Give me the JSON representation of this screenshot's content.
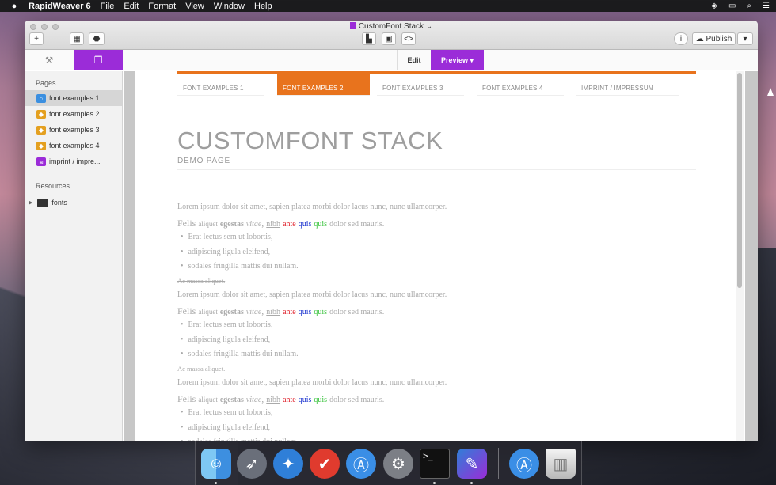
{
  "menubar": {
    "apple": "",
    "items": [
      "RapidWeaver 6",
      "File",
      "Edit",
      "Format",
      "View",
      "Window",
      "Help"
    ]
  },
  "window": {
    "title": "CustomFont Stack",
    "title_chevron": "⌄",
    "toolbar": {
      "add": "+",
      "archive": "▦",
      "plugin": "⬣",
      "view1": "▙",
      "view2": "▣",
      "code": "<>",
      "info": "i",
      "publish": "Publish",
      "publish_menu": "▾"
    },
    "tabs": {
      "edit": "Edit",
      "preview": "Preview ▾"
    }
  },
  "sidebar": {
    "pages_header": "Pages",
    "pages": [
      {
        "label": "font examples 1",
        "icon": "home-page-icon",
        "color": "#3b8fe0",
        "selected": true
      },
      {
        "label": "font examples 2",
        "icon": "stacks-page-icon",
        "color": "#e4a020",
        "selected": false
      },
      {
        "label": "font examples 3",
        "icon": "stacks-page-icon",
        "color": "#e4a020",
        "selected": false
      },
      {
        "label": "font examples 4",
        "icon": "stacks-page-icon",
        "color": "#e4a020",
        "selected": false
      },
      {
        "label": "imprint / impre...",
        "icon": "html-page-icon",
        "color": "#9b2cd8",
        "selected": false
      }
    ],
    "resources_header": "Resources",
    "resources": [
      {
        "label": "fonts",
        "icon": "folder-icon"
      }
    ]
  },
  "site": {
    "nav": [
      "FONT EXAMPLES 1",
      "FONT EXAMPLES 2",
      "FONT EXAMPLES 3",
      "FONT EXAMPLES 4",
      "IMPRINT / IMPRESSUM"
    ],
    "active_nav": 1,
    "title": "CUSTOMFONT STACK",
    "subtitle": "DEMO PAGE",
    "lorem": "Lorem ipsum dolor sit amet, sapien platea morbi dolor lacus nunc, nunc ullamcorper.",
    "felis": {
      "w1": "Felis",
      "w2": "aliquet",
      "w3": "egestas",
      "w4": "vitae",
      "w5": "nibh",
      "w6": "ante",
      "w7": "quis",
      "w8": "quis",
      "w9": "dolor sed mauris."
    },
    "bullets": [
      "Erat lectus sem ut lobortis,",
      "adipiscing ligula eleifend,",
      "sodales fringilla mattis dui nullam."
    ],
    "strike": "Ac massa aliquet."
  },
  "dock": [
    "finder-icon",
    "launchpad-icon",
    "safari-icon",
    "todo-icon",
    "app-store-icon",
    "system-preferences-icon",
    "terminal-icon",
    "rapidweaver-icon",
    "app-store-icon",
    "trash-icon"
  ],
  "colors": {
    "accent": "#9b2cd8",
    "site_orange": "#e8731d"
  }
}
